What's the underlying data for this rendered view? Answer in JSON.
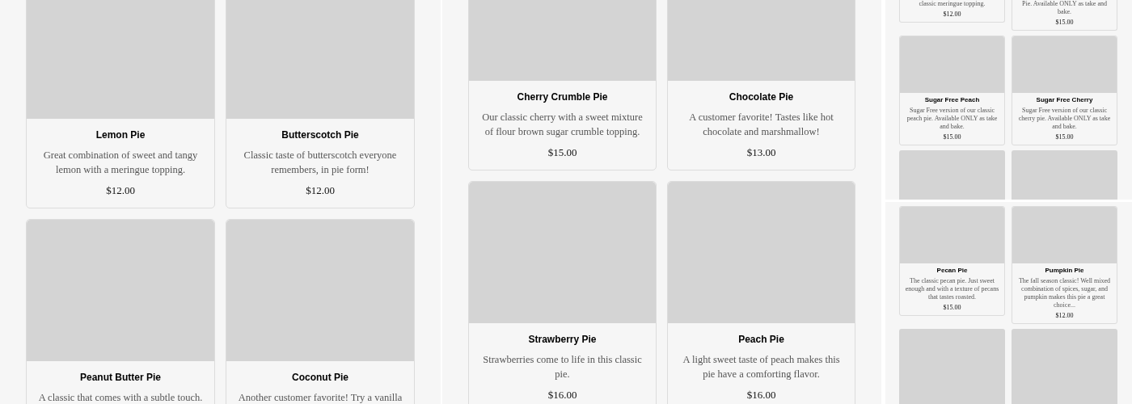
{
  "panels": [
    {
      "kind": "large",
      "cards": [
        {
          "kind": "full",
          "name": "Lemon Pie",
          "description": "Great combination of sweet and tangy lemon with a meringue topping.",
          "price": "$12.00"
        },
        {
          "kind": "full",
          "name": "Butterscotch Pie",
          "description": "Classic taste of butterscotch everyone remembers, in pie form!",
          "price": "$12.00"
        },
        {
          "kind": "full",
          "name": "Peanut Butter Pie",
          "description": "A classic that comes with a subtle touch."
        },
        {
          "kind": "full",
          "name": "Coconut Pie",
          "description": "Another customer favorite! Try a vanilla"
        }
      ]
    },
    {
      "kind": "large",
      "cards": [
        {
          "kind": "full",
          "name": "Cherry Crumble Pie",
          "description": "Our classic cherry with a sweet mixture of flour brown sugar crumble topping.",
          "price": "$15.00"
        },
        {
          "kind": "full",
          "name": "Chocolate Pie",
          "description": "A customer favorite! Tastes like hot chocolate and marshmallow!",
          "price": "$13.00"
        },
        {
          "kind": "full",
          "name": "Strawberry Pie",
          "description": "Strawberries come to life in this classic pie.",
          "price": "$16.00"
        },
        {
          "kind": "full",
          "name": "Peach Pie",
          "description": "A light sweet taste of peach makes this pie have a comforting flavor.",
          "price": "$16.00"
        }
      ]
    },
    {
      "kind": "small",
      "cards": [
        {
          "kind": "text_only",
          "description": "classic meringue topping.",
          "price": "$12.00"
        },
        {
          "kind": "text_only",
          "description": "Pie. Available ONLY as take and bake.",
          "price": "$15.00"
        },
        {
          "kind": "full",
          "name": "Sugar Free Peach",
          "description": "Sugar Free version of our classic peach pie. Available ONLY as take and bake.",
          "price": "$15.00"
        },
        {
          "kind": "full",
          "name": "Sugar Free Cherry",
          "description": "Sugar Free version of our classic cherry pie. Available ONLY as take and bake.",
          "price": "$15.00"
        },
        {
          "kind": "image_only"
        },
        {
          "kind": "image_only"
        }
      ]
    },
    {
      "kind": "small",
      "cards": [
        {
          "kind": "full",
          "name": "Pecan Pie",
          "description": "The classic pecan pie. Just sweet enough and with a texture of pecans that tastes roasted.",
          "price": "$15.00"
        },
        {
          "kind": "full",
          "name": "Pumpkin Pie",
          "description": "The fall season classic! Well mixed combination of spices, sugar, and pumpkin makes this pie a great choice...",
          "price": "$12.00"
        },
        {
          "kind": "image_only"
        },
        {
          "kind": "image_only"
        }
      ]
    }
  ]
}
